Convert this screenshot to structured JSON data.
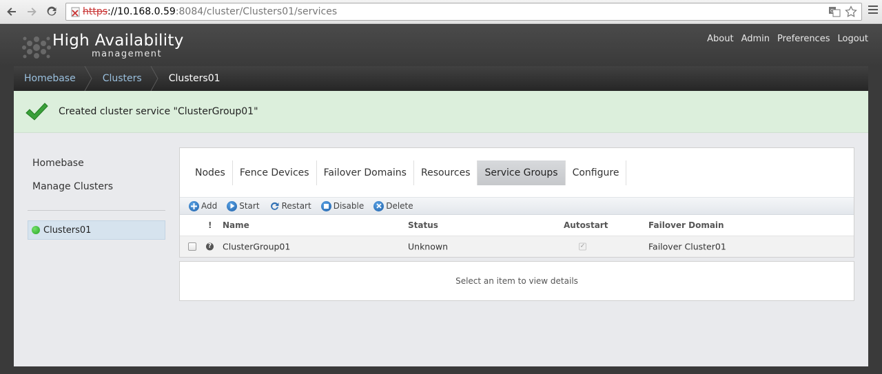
{
  "browser": {
    "url_scheme": "https",
    "url_host": "://10.168.0.59",
    "url_path": ":8084/cluster/Clusters01/services"
  },
  "app": {
    "title": "High Availability",
    "subtitle": "management",
    "top_links": [
      "About",
      "Admin",
      "Preferences",
      "Logout"
    ]
  },
  "breadcrumb": [
    "Homebase",
    "Clusters",
    "Clusters01"
  ],
  "notice": {
    "text": "Created cluster service \"ClusterGroup01\""
  },
  "sidebar": {
    "items": [
      "Homebase",
      "Manage Clusters"
    ],
    "cluster": "Clusters01",
    "cluster_status_color": "#25a524"
  },
  "tabs": [
    "Nodes",
    "Fence Devices",
    "Failover Domains",
    "Resources",
    "Service Groups",
    "Configure"
  ],
  "active_tab": "Service Groups",
  "toolbar": [
    "Add",
    "Start",
    "Restart",
    "Disable",
    "Delete"
  ],
  "table": {
    "headers": [
      "!",
      "Name",
      "Status",
      "Autostart",
      "Failover Domain"
    ],
    "rows": [
      {
        "name": "ClusterGroup01",
        "status": "Unknown",
        "autostart": true,
        "failover_domain": "Failover Cluster01"
      }
    ]
  },
  "details": {
    "placeholder": "Select an item to view details"
  }
}
